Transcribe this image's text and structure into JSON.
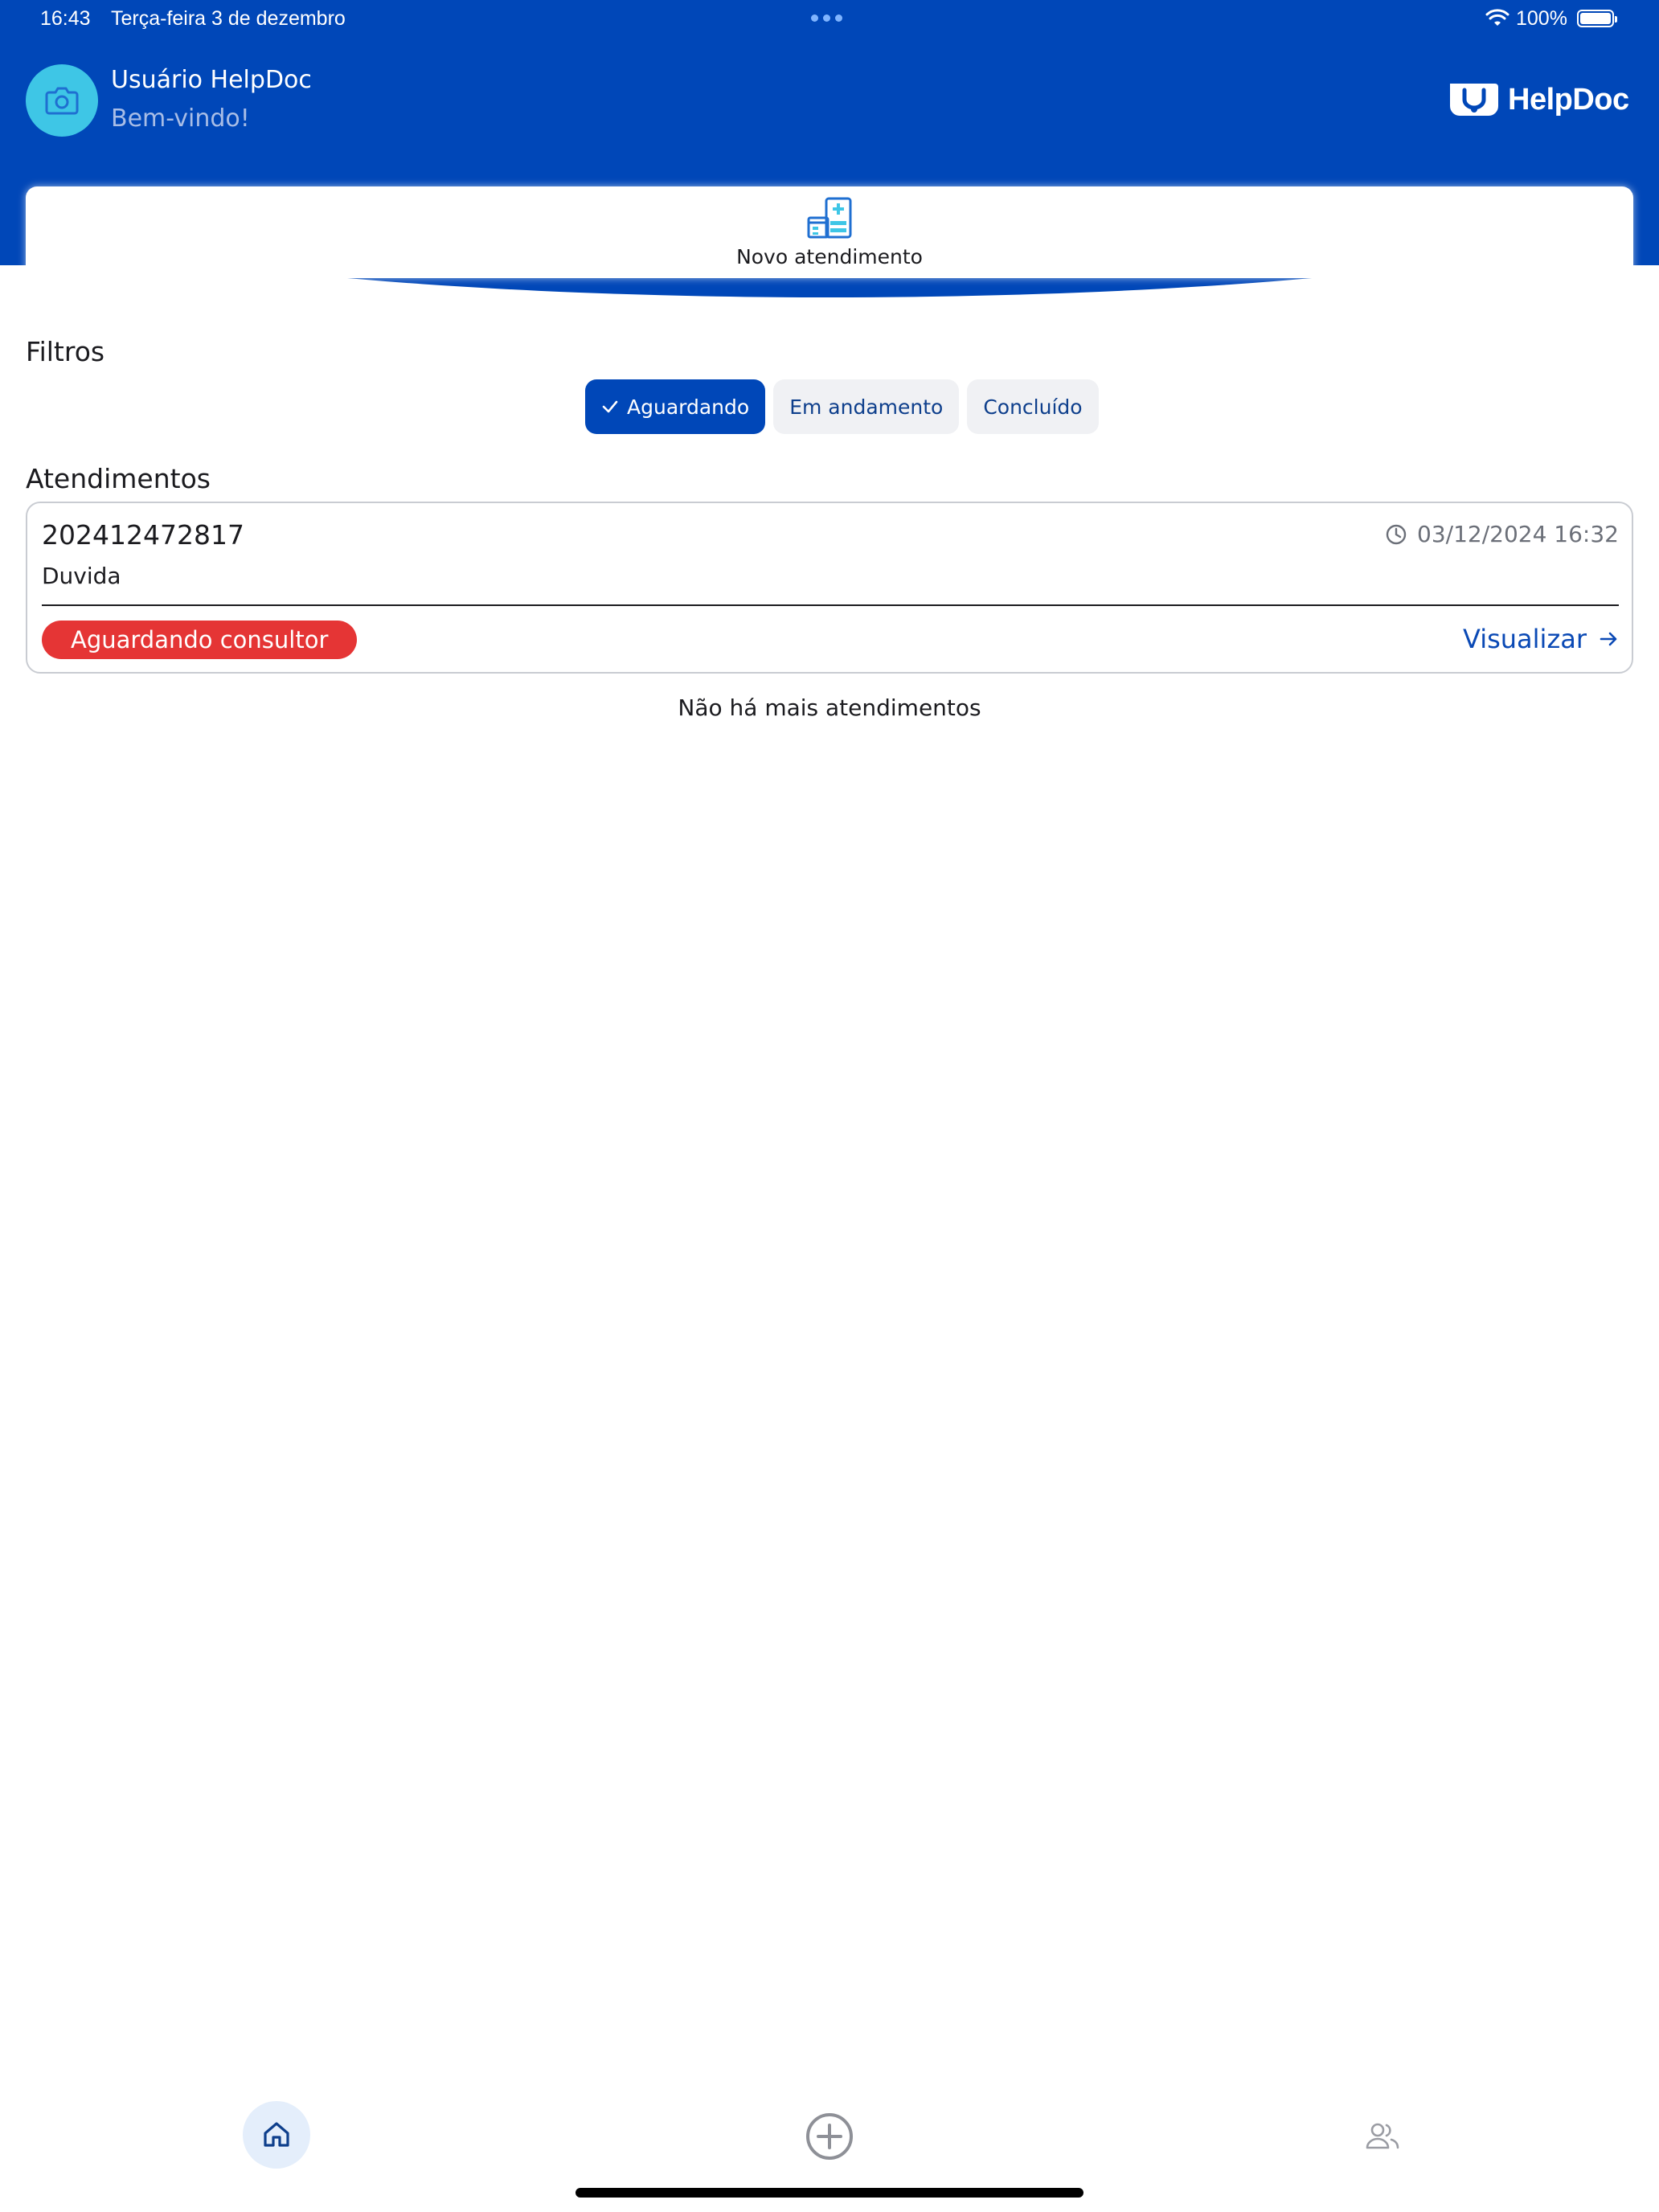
{
  "status_bar": {
    "time": "16:43",
    "date": "Terça-feira 3 de dezembro",
    "battery": "100%"
  },
  "header": {
    "user_name": "Usuário HelpDoc",
    "welcome": "Bem-vindo!",
    "brand": "HelpDoc"
  },
  "new_service": {
    "label": "Novo atendimento"
  },
  "filters": {
    "title": "Filtros",
    "options": [
      {
        "label": "Aguardando",
        "selected": true
      },
      {
        "label": "Em andamento",
        "selected": false
      },
      {
        "label": "Concluído",
        "selected": false
      }
    ]
  },
  "list": {
    "title": "Atendimentos",
    "items": [
      {
        "id": "202412472817",
        "datetime": "03/12/2024 16:32",
        "subject": "Duvida",
        "status": "Aguardando consultor",
        "action": "Visualizar"
      }
    ],
    "end_message": "Não há mais atendimentos"
  },
  "bottom_nav": {
    "items": [
      {
        "icon": "home-icon",
        "active": true
      },
      {
        "icon": "add-circle-icon",
        "active": false
      },
      {
        "icon": "users-icon",
        "active": false
      }
    ]
  },
  "colors": {
    "primary": "#0047b8",
    "accent": "#3ec6e6",
    "status_waiting": "#e53535",
    "chip_bg": "#f0f1f4"
  }
}
